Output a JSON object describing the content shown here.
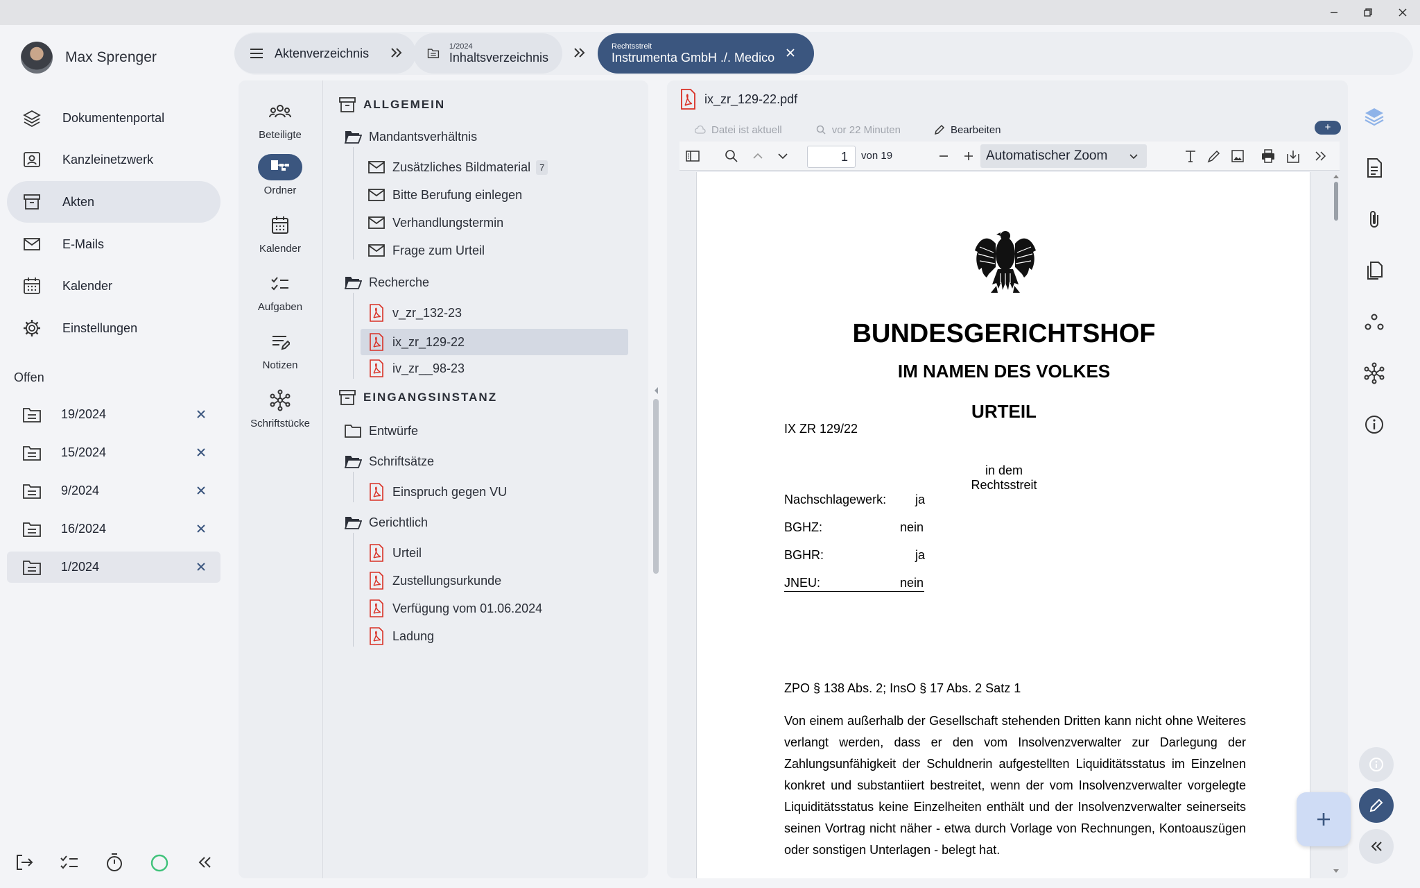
{
  "user": {
    "name": "Max Sprenger"
  },
  "nav": {
    "items": [
      {
        "label": "Dokumentenportal",
        "icon": "layers-icon"
      },
      {
        "label": "Kanzleinetzwerk",
        "icon": "contact-card-icon"
      },
      {
        "label": "Akten",
        "icon": "archive-icon"
      },
      {
        "label": "E-Mails",
        "icon": "mail-icon"
      },
      {
        "label": "Kalender",
        "icon": "calendar-icon"
      },
      {
        "label": "Einstellungen",
        "icon": "gear-icon"
      }
    ],
    "active": "Akten"
  },
  "open": {
    "heading": "Offen",
    "items": [
      {
        "label": "19/2024"
      },
      {
        "label": "15/2024"
      },
      {
        "label": "9/2024"
      },
      {
        "label": "16/2024"
      },
      {
        "label": "1/2024"
      }
    ]
  },
  "breadcrumb": {
    "first": {
      "label": "Aktenverzeichnis"
    },
    "second": {
      "small": "1/2024",
      "label": "Inhaltsverzeichnis"
    },
    "third": {
      "small": "Rechtsstreit",
      "label": "Instrumenta GmbH ./. Medico"
    }
  },
  "tools": [
    {
      "label": "Beteiligte"
    },
    {
      "label": "Ordner"
    },
    {
      "label": "Kalender"
    },
    {
      "label": "Aufgaben"
    },
    {
      "label": "Notizen"
    },
    {
      "label": "Schriftstücke"
    }
  ],
  "tree": {
    "allgemein": "ALLGEMEIN",
    "mandantsverhaeltnis": "Mandantsverhältnis",
    "mails": [
      "Zusätzliches Bildmaterial",
      "Bitte Berufung einlegen",
      "Verhandlungstermin",
      "Frage zum Urteil"
    ],
    "mailBadge": "7",
    "recherche": "Recherche",
    "rechercheFiles": [
      "v_zr_132-23",
      "ix_zr_129-22",
      "iv_zr__98-23"
    ],
    "eingangsinstanz": "EINGANGSINSTANZ",
    "entwuerfe": "Entwürfe",
    "schriftsaetze": "Schriftsätze",
    "schriftsaetzeFiles": [
      "Einspruch gegen VU"
    ],
    "gerichtlich": "Gerichtlich",
    "gerichtlichFiles": [
      "Urteil",
      "Zustellungsurkunde",
      "Verfügung vom 01.06.2024",
      "Ladung"
    ]
  },
  "viewer": {
    "filename": "ix_zr_129-22.pdf",
    "status": "Datei ist aktuell",
    "time": "vor 22 Minuten",
    "edit": "Bearbeiten",
    "plus": "+",
    "page": "1",
    "of": "von 19",
    "zoom": "Automatischer Zoom"
  },
  "document": {
    "court": "BUNDESGERICHTSHOF",
    "inname": "IM NAMEN DES VOLKES",
    "urteil": "URTEIL",
    "az": "IX ZR 129/22",
    "rechtsstreit": "in dem Rechtsstreit",
    "rows": [
      {
        "k": "Nachschlagewerk:",
        "v": "ja"
      },
      {
        "k": "BGHZ:",
        "v": "nein"
      },
      {
        "k": "BGHR:",
        "v": "ja"
      },
      {
        "k": "JNEU:",
        "v": "nein"
      }
    ],
    "norms": "ZPO § 138 Abs. 2; InsO § 17 Abs. 2 Satz 1",
    "leitsatz": "Von einem außerhalb der Gesellschaft stehenden Dritten kann nicht ohne Weiteres verlangt werden, dass er den vom Insolvenzverwalter zur Darlegung der Zahlungsunfähigkeit der Schuldnerin aufgestellten Liquiditätsstatus im Einzelnen konkret und substantiiert bestreitet, wenn der vom Insolvenzverwalter vorgelegte Liquiditätsstatus keine Einzelheiten enthält und der Insolvenzverwalter seinerseits seinen Vortrag nicht näher - etwa durch Vorlage von Rechnungen, Kontoauszügen oder sonstigen Unterlagen - belegt hat."
  },
  "colors": {
    "accent": "#3b567f",
    "pdfRed": "#d93025",
    "status": "#3fc27a"
  }
}
